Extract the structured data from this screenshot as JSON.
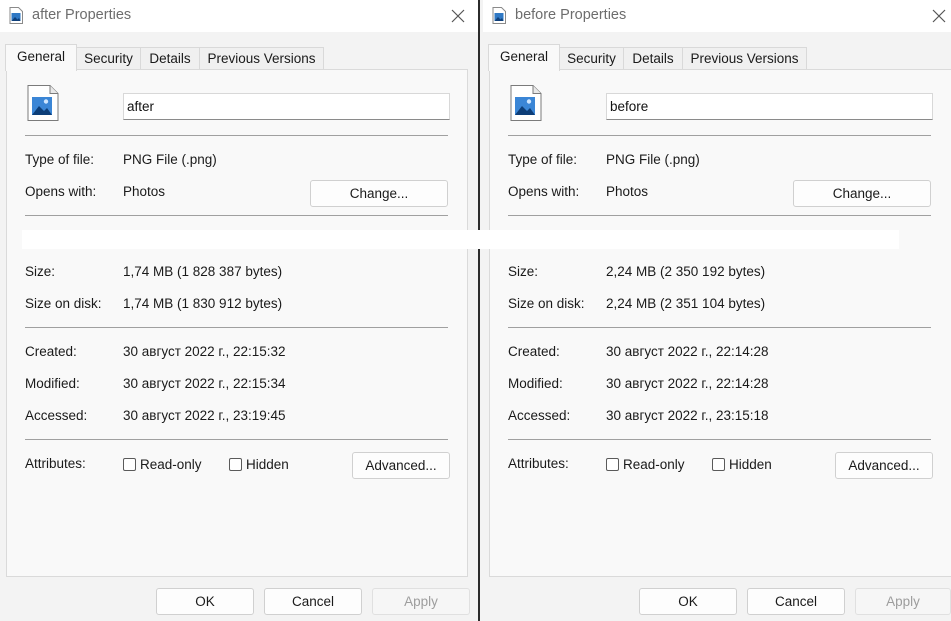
{
  "dialogs": [
    {
      "title": "after Properties",
      "tabs": [
        "General",
        "Security",
        "Details",
        "Previous Versions"
      ],
      "file_name": "after",
      "type_label": "Type of file:",
      "type_value": "PNG File (.png)",
      "opens_label": "Opens with:",
      "opens_value": "Photos",
      "change_label": "Change...",
      "size_label": "Size:",
      "size_value": "1,74 MB (1 828 387 bytes)",
      "disk_label": "Size on disk:",
      "disk_value": "1,74 MB (1 830 912 bytes)",
      "created_label": "Created:",
      "created_value": "30 август 2022 г., 22:15:32",
      "modified_label": "Modified:",
      "modified_value": "30 август 2022 г., 22:15:34",
      "accessed_label": "Accessed:",
      "accessed_value": "30 август 2022 г., 23:19:45",
      "attributes_label": "Attributes:",
      "readonly_label": "Read-only",
      "hidden_label": "Hidden",
      "advanced_label": "Advanced...",
      "ok_label": "OK",
      "cancel_label": "Cancel",
      "apply_label": "Apply"
    },
    {
      "title": "before Properties",
      "tabs": [
        "General",
        "Security",
        "Details",
        "Previous Versions"
      ],
      "file_name": "before",
      "type_label": "Type of file:",
      "type_value": "PNG File (.png)",
      "opens_label": "Opens with:",
      "opens_value": "Photos",
      "change_label": "Change...",
      "size_label": "Size:",
      "size_value": "2,24 MB (2 350 192 bytes)",
      "disk_label": "Size on disk:",
      "disk_value": "2,24 MB (2 351 104 bytes)",
      "created_label": "Created:",
      "created_value": "30 август 2022 г., 22:14:28",
      "modified_label": "Modified:",
      "modified_value": "30 август 2022 г., 22:14:28",
      "accessed_label": "Accessed:",
      "accessed_value": "30 август 2022 г., 23:15:18",
      "attributes_label": "Attributes:",
      "readonly_label": "Read-only",
      "hidden_label": "Hidden",
      "advanced_label": "Advanced...",
      "ok_label": "OK",
      "cancel_label": "Cancel",
      "apply_label": "Apply"
    }
  ],
  "colors": {
    "accent_icon": "#2f78c4",
    "window_bg": "#f3f3f3",
    "panel_bg": "#f9f9f9",
    "title_text": "#6d6d6d"
  },
  "icons": {
    "title_icon": "image-file-icon",
    "close": "close-icon",
    "file": "image-file-icon"
  }
}
